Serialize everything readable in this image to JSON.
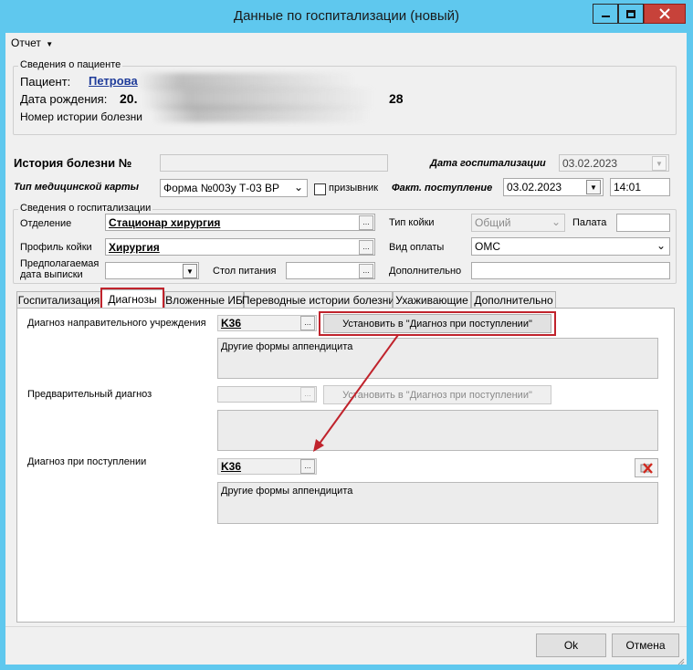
{
  "window": {
    "title": "Данные по госпитализации (новый)"
  },
  "menu": {
    "report": "Отчет"
  },
  "patient": {
    "legend": "Сведения о пациенте",
    "patient_label": "Пациент:",
    "patient_value": "Петрова",
    "dob_label": "Дата рождения:",
    "dob_value": "20.",
    "age_value": "28",
    "history_label": "Номер истории болезни"
  },
  "header_fields": {
    "history_no_label": "История болезни №",
    "hosp_date_label": "Дата госпитализации",
    "hosp_date_value": "03.02.2023",
    "card_type_label": "Тип медицинской карты",
    "card_type_value": "Форма №003у Т-03 ВР",
    "conscript_label": "призывник",
    "admission_label": "Факт. поступление",
    "admission_date": "03.02.2023",
    "admission_time": "14:01"
  },
  "hosp_info": {
    "legend": "Сведения о госпитализации",
    "department_label": "Отделение",
    "department_value": "Стационар  хирургия",
    "bed_profile_label": "Профиль койки",
    "bed_profile_value": "Хирургия",
    "discharge_label_1": "Предполагаемая",
    "discharge_label_2": "дата выписки",
    "diet_label": "Стол питания",
    "bed_type_label": "Тип койки",
    "bed_type_value": "Общий",
    "ward_label": "Палата",
    "payment_label": "Вид оплаты",
    "payment_value": "ОМС",
    "additional_label": "Дополнительно"
  },
  "tabs": [
    {
      "label": "Госпитализация"
    },
    {
      "label": "Диагнозы"
    },
    {
      "label": "Вложенные ИБ"
    },
    {
      "label": "Переводные истории болезни"
    },
    {
      "label": "Ухаживающие"
    },
    {
      "label": "Дополнительно"
    }
  ],
  "diagnoses": {
    "referral_label": "Диагноз направительного учреждения",
    "referral_code": "K36",
    "referral_button": "Установить в \"Диагноз при поступлении\"",
    "referral_text": "Другие формы аппендицита",
    "preliminary_label": "Предварительный диагноз",
    "preliminary_button": "Установить в \"Диагноз при поступлении\"",
    "admission_label": "Диагноз при поступлении",
    "admission_code": "K36",
    "admission_text": "Другие формы аппендицита"
  },
  "footer": {
    "ok": "Ok",
    "cancel": "Отмена"
  },
  "colors": {
    "titlebar": "#5fc8ee",
    "highlight": "#c0232c",
    "link": "#1f3c9a"
  }
}
